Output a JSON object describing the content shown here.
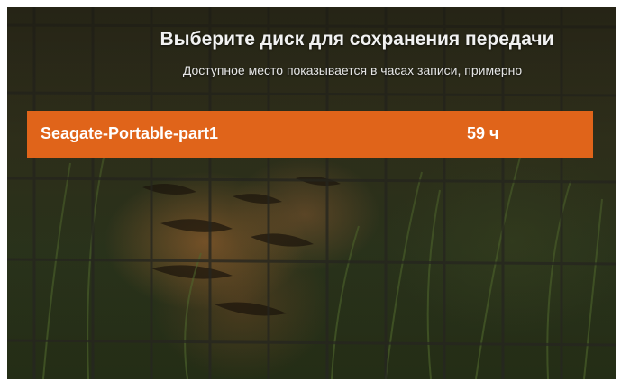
{
  "dialog": {
    "title": "Выберите диск для сохранения передачи",
    "subtitle": "Доступное место показывается в часах записи, примерно"
  },
  "disks": [
    {
      "name": "Seagate-Portable-part1",
      "space": "59 ч",
      "selected": true
    }
  ],
  "colors": {
    "highlight": "#e0641a",
    "text": "#ffffff"
  },
  "background": {
    "description_icon": "tiger-behind-fence-image"
  }
}
